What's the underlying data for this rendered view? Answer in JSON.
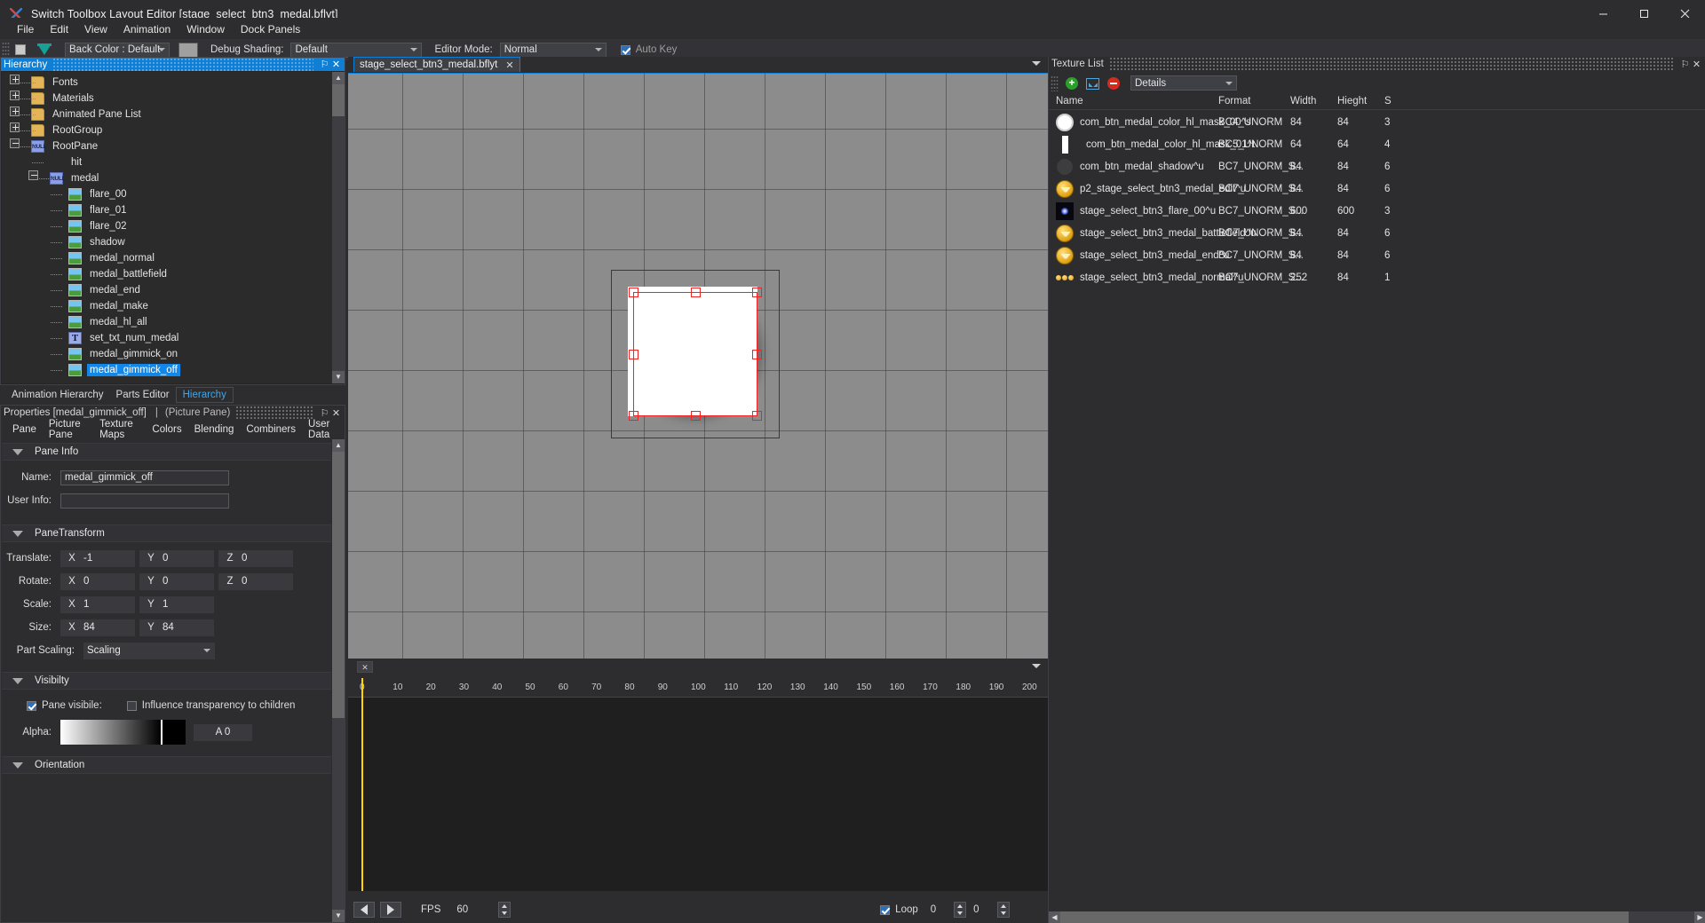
{
  "window": {
    "title": "Switch Toolbox Layout Editor [stage_select_btn3_medal.bflyt]",
    "minimize": "–",
    "maximize": "□",
    "close": "✕"
  },
  "menubar": {
    "items": [
      "File",
      "Edit",
      "View",
      "Animation",
      "Window",
      "Dock Panels"
    ]
  },
  "toolbar": {
    "back_color": "Back Color : Default",
    "debug_shading_label": "Debug Shading:",
    "debug_shading_value": "Default",
    "editor_mode_label": "Editor Mode:",
    "editor_mode_value": "Normal",
    "auto_key_label": "Auto Key",
    "auto_key_checked": true
  },
  "hierarchy": {
    "title": "Hierarchy",
    "pin": "⚐",
    "close": "✕",
    "tree": [
      {
        "label": "Fonts",
        "icon": "folder-icon",
        "indent": 0,
        "expander": "plus",
        "selected": false
      },
      {
        "label": "Materials",
        "icon": "folder-icon",
        "indent": 0,
        "expander": "plus",
        "selected": false
      },
      {
        "label": "Animated Pane List",
        "icon": "folder-icon",
        "indent": 0,
        "expander": "plus",
        "selected": false
      },
      {
        "label": "RootGroup",
        "icon": "folder-icon",
        "indent": 0,
        "expander": "plus",
        "selected": false
      },
      {
        "label": "RootPane",
        "icon": "null-pane-icon",
        "indent": 0,
        "expander": "minus",
        "selected": false,
        "badge": "NULL"
      },
      {
        "label": "hit",
        "icon": "none",
        "indent": 1,
        "expander": "none",
        "selected": false
      },
      {
        "label": "medal",
        "icon": "null-pane-icon",
        "indent": 1,
        "expander": "minus",
        "selected": false,
        "badge": "NULL"
      },
      {
        "label": "flare_00",
        "icon": "picture-icon",
        "indent": 2,
        "expander": "none",
        "selected": false
      },
      {
        "label": "flare_01",
        "icon": "picture-icon",
        "indent": 2,
        "expander": "none",
        "selected": false
      },
      {
        "label": "flare_02",
        "icon": "picture-icon",
        "indent": 2,
        "expander": "none",
        "selected": false
      },
      {
        "label": "shadow",
        "icon": "picture-icon",
        "indent": 2,
        "expander": "none",
        "selected": false
      },
      {
        "label": "medal_normal",
        "icon": "picture-icon",
        "indent": 2,
        "expander": "none",
        "selected": false
      },
      {
        "label": "medal_battlefield",
        "icon": "picture-icon",
        "indent": 2,
        "expander": "none",
        "selected": false
      },
      {
        "label": "medal_end",
        "icon": "picture-icon",
        "indent": 2,
        "expander": "none",
        "selected": false
      },
      {
        "label": "medal_make",
        "icon": "picture-icon",
        "indent": 2,
        "expander": "none",
        "selected": false
      },
      {
        "label": "medal_hl_all",
        "icon": "picture-icon",
        "indent": 2,
        "expander": "none",
        "selected": false
      },
      {
        "label": "set_txt_num_medal",
        "icon": "text-pane-icon",
        "indent": 2,
        "expander": "none",
        "selected": false,
        "badge": "T"
      },
      {
        "label": "medal_gimmick_on",
        "icon": "picture-icon",
        "indent": 2,
        "expander": "none",
        "selected": false
      },
      {
        "label": "medal_gimmick_off",
        "icon": "picture-icon",
        "indent": 2,
        "expander": "none",
        "selected": true
      }
    ],
    "bottom_tabs": [
      {
        "label": "Animation Hierarchy",
        "active": false
      },
      {
        "label": "Parts Editor",
        "active": false
      },
      {
        "label": "Hierarchy",
        "active": true
      }
    ]
  },
  "properties": {
    "title": "Properties [medal_gimmick_off]",
    "separator": "|",
    "subtitle": "(Picture Pane)",
    "pin": "⚐",
    "close": "✕",
    "tabs": [
      "Pane",
      "Picture Pane",
      "Texture Maps",
      "Colors",
      "Blending",
      "Combiners",
      "User Data"
    ],
    "pane_info": {
      "section_title": "Pane Info",
      "name_label": "Name:",
      "name_value": "medal_gimmick_off",
      "user_info_label": "User Info:",
      "user_info_value": ""
    },
    "pane_transform": {
      "section_title": "PaneTransform",
      "translate_label": "Translate:",
      "translate": {
        "x": "-1",
        "y": "0",
        "z": "0"
      },
      "rotate_label": "Rotate:",
      "rotate": {
        "x": "0",
        "y": "0",
        "z": "0"
      },
      "scale_label": "Scale:",
      "scale": {
        "x": "1",
        "y": "1"
      },
      "size_label": "Size:",
      "size": {
        "x": "84",
        "y": "84"
      },
      "part_scaling_label": "Part Scaling:",
      "part_scaling_value": "Scaling",
      "axis_x": "X",
      "axis_y": "Y",
      "axis_z": "Z"
    },
    "visibility": {
      "section_title": "Visibilty",
      "pane_visible_label": "Pane visibile:",
      "pane_visible_checked": true,
      "influence_label": "Influence transparency to children",
      "influence_checked": false,
      "alpha_label": "Alpha:",
      "alpha_value": "A  0"
    },
    "orientation": {
      "section_title": "Orientation"
    }
  },
  "document": {
    "tab_label": "stage_select_btn3_medal.bflyt",
    "tab_close": "✕"
  },
  "timeline": {
    "tab_close": "✕",
    "ticks": [
      "0",
      "10",
      "20",
      "30",
      "40",
      "50",
      "60",
      "70",
      "80",
      "90",
      "100",
      "110",
      "120",
      "130",
      "140",
      "150",
      "160",
      "170",
      "180",
      "190",
      "200"
    ],
    "fps_label": "FPS",
    "fps_value": "60",
    "loop_label": "Loop",
    "loop_checked": true,
    "loop_value": "0",
    "frame_value": "0",
    "play_prev": "◀",
    "play_next": "▶"
  },
  "texture_list": {
    "title": "Texture List",
    "pin": "⚐",
    "close": "✕",
    "add_icon": "+",
    "view_mode": "Details",
    "columns": [
      "Name",
      "Format",
      "Width",
      "Hieght",
      "S"
    ],
    "rows": [
      {
        "thumb": "ring",
        "name": "com_btn_medal_color_hl_mask_00^s",
        "format": "BC4_UNORM",
        "width": "84",
        "height": "84",
        "size": "3"
      },
      {
        "thumb": "bar",
        "name": "com_btn_medal_color_hl_mask_01^t",
        "format": "BC5_UNORM",
        "width": "64",
        "height": "64",
        "size": "4"
      },
      {
        "thumb": "dark",
        "name": "com_btn_medal_shadow^u",
        "format": "BC7_UNORM_S...",
        "width": "84",
        "height": "84",
        "size": "6"
      },
      {
        "thumb": "coin",
        "name": "p2_stage_select_btn3_medal_edit^u",
        "format": "BC7_UNORM_S...",
        "width": "84",
        "height": "84",
        "size": "6"
      },
      {
        "thumb": "flare",
        "name": "stage_select_btn3_flare_00^u",
        "format": "BC7_UNORM_S...",
        "width": "600",
        "height": "600",
        "size": "3"
      },
      {
        "thumb": "coin",
        "name": "stage_select_btn3_medal_battlefield^u",
        "format": "BC7_UNORM_S...",
        "width": "84",
        "height": "84",
        "size": "6"
      },
      {
        "thumb": "coin",
        "name": "stage_select_btn3_medal_end^u",
        "format": "BC7_UNORM_S...",
        "width": "84",
        "height": "84",
        "size": "6"
      },
      {
        "thumb": "coins",
        "name": "stage_select_btn3_medal_normal^u",
        "format": "BC7_UNORM_S...",
        "width": "252",
        "height": "84",
        "size": "1"
      }
    ]
  }
}
